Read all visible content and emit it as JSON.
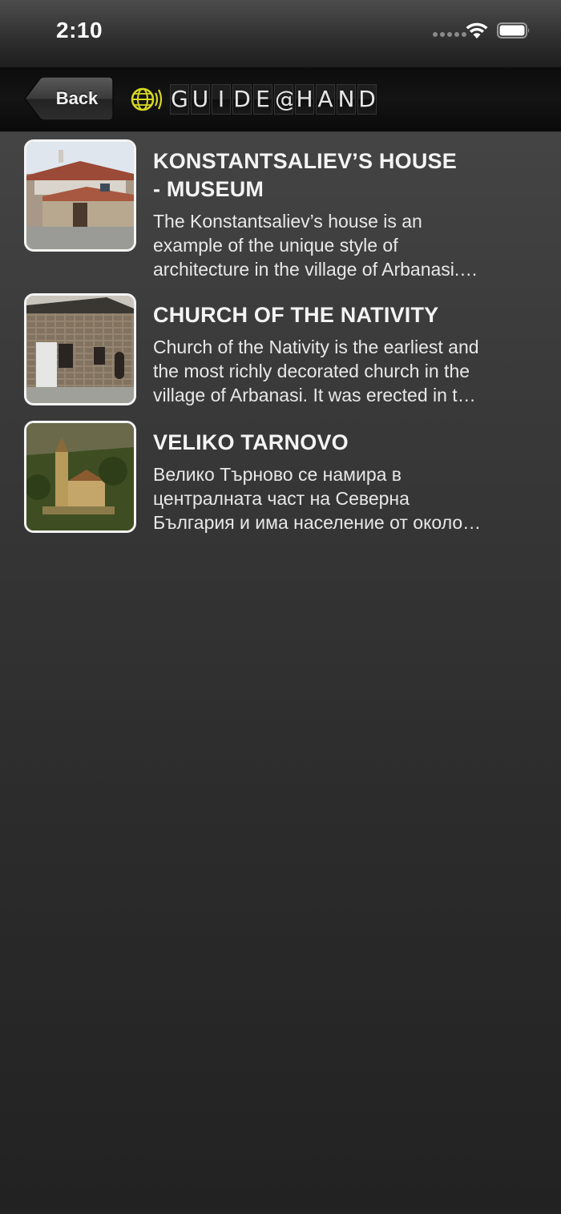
{
  "status_bar": {
    "time": "2:10"
  },
  "nav": {
    "back_label": "Back",
    "logo_letters": [
      "G",
      "U",
      "I",
      "D",
      "E",
      "@",
      "H",
      "A",
      "N",
      "D"
    ]
  },
  "items": [
    {
      "title_line1": "KONSTANTSALIEV’S HOUSE",
      "title_line2": "- MUSEUM",
      "desc_lines": [
        "The Konstantsaliev’s house is an",
        "example of the unique style of",
        "architecture in the village of Arbanasi.…"
      ]
    },
    {
      "title_line1": "CHURCH OF THE NATIVITY",
      "desc_lines": [
        "Church of the Nativity is the earliest and",
        "the most richly decorated church in the",
        "village of Arbanasi. It was erected in t…"
      ]
    },
    {
      "title_line1": "VELIKO TARNOVO",
      "desc_lines": [
        "Велико Търново се намира в",
        "централната част на Северна",
        "България и има население от около…"
      ]
    }
  ]
}
